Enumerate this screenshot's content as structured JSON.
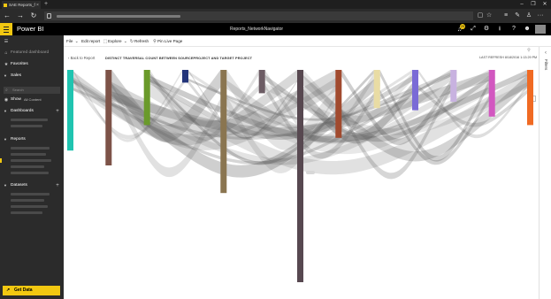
{
  "browser": {
    "tab_title": "SAE Reports_f",
    "tab_close": "×",
    "new_tab": "+",
    "nav_back": "←",
    "nav_forward": "→",
    "nav_refresh": "↻",
    "window_minimize": "–",
    "window_restore": "❐",
    "window_close": "✕",
    "tools": [
      "▢",
      "☆",
      "≡",
      "✎",
      "♙",
      "···"
    ]
  },
  "header": {
    "brand": "Power BI",
    "report_title": "Reports_NetworkNavigator",
    "notification_count": "29",
    "icons": [
      "notification-icon",
      "expand-icon",
      "settings-icon",
      "download-icon",
      "help-icon",
      "smiley-icon"
    ]
  },
  "nav": {
    "featured": "Featured dashboard",
    "favorites": "Favorites",
    "workspace": "Sales",
    "search_placeholder": "Search",
    "show_label": "Show",
    "show_value": "All Content",
    "dashboards": "Dashboards",
    "reports": "Reports",
    "datasets": "Datasets",
    "get_data": "Get Data"
  },
  "commandbar": {
    "file": "File",
    "edit": "Edit report",
    "explore": "Explore",
    "refresh": "Refresh",
    "pin": "Pin Live Page"
  },
  "visual": {
    "back": "Back to Report",
    "title": "DISTINCT TRAVERSAL COUNT BETWEEN SOURCEPROJECT AND TARGET PROJECT",
    "last_refreshed": "LAST REFRESH 8/18/2016 1:13:29 PM"
  },
  "filters": {
    "label": "Filters",
    "chevron": "‹"
  },
  "chart_data": {
    "type": "sankey",
    "title": "DISTINCT TRAVERSAL COUNT BETWEEN SOURCEPROJECT AND TARGET PROJECT",
    "nodes": [
      {
        "color": "#20c4b0",
        "size": 0.38
      },
      {
        "color": "#7d5348",
        "size": 0.45
      },
      {
        "color": "#6a9a2a",
        "size": 0.26
      },
      {
        "color": "#23347a",
        "size": 0.06
      },
      {
        "color": "#8a7550",
        "size": 0.58
      },
      {
        "color": "#6c5c64",
        "size": 0.11
      },
      {
        "color": "#574850",
        "size": 1.0
      },
      {
        "color": "#a14a2e",
        "size": 0.32
      },
      {
        "color": "#e9dca4",
        "size": 0.18
      },
      {
        "color": "#7a6bd6",
        "size": 0.19
      },
      {
        "color": "#c8b2e0",
        "size": 0.15
      },
      {
        "color": "#d257c0",
        "size": 0.22
      },
      {
        "color": "#f06a23",
        "size": 0.26
      }
    ]
  }
}
